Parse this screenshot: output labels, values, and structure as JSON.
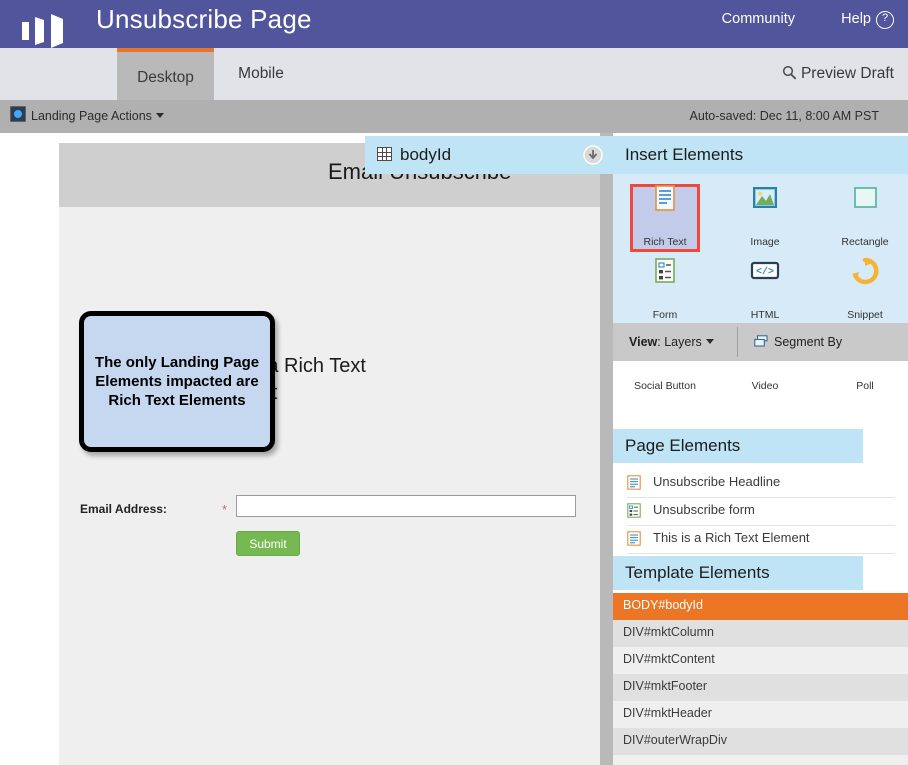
{
  "header": {
    "title": "Unsubscribe Page",
    "community_label": "Community",
    "help_label": "Help",
    "help_icon": "question-circle-icon",
    "logo_icon": "marketo-logo-icon",
    "bg_color": "#51559b"
  },
  "tabs": {
    "items": [
      {
        "label": "Desktop",
        "active": true
      },
      {
        "label": "Mobile",
        "active": false
      }
    ],
    "preview_label": "Preview Draft",
    "preview_icon": "search-icon",
    "active_accent": "#e8762a"
  },
  "action_bar": {
    "landing_page_actions": "Landing Page Actions",
    "actions_icon": "gear-globe-icon",
    "caret_icon": "caret-down-icon",
    "auto_saved": "Auto-saved: Dec 11, 8:00 AM PST"
  },
  "bodyid_bar": {
    "label": "bodyId",
    "grid_icon": "table-grid-icon",
    "download_icon": "arrow-down-circle-icon"
  },
  "canvas": {
    "headline": "Email Unsubscribe",
    "rich_text": "This is a Rich Text Element",
    "form": {
      "email_label": "Email Address:",
      "required_marker": "*",
      "email_value": "",
      "email_placeholder": "",
      "submit_label": "Submit",
      "submit_color": "#76b852"
    },
    "callout": {
      "text": "The only Landing Page Elements impacted are Rich Text Elements",
      "bg_color": "#c5d8f0",
      "border_color": "#000000"
    }
  },
  "right_panel": {
    "insert_title": "Insert Elements",
    "insert_elements": [
      {
        "label": "Rich Text",
        "icon": "rich-text-icon",
        "selected": true
      },
      {
        "label": "Image",
        "icon": "image-icon",
        "selected": false
      },
      {
        "label": "Rectangle",
        "icon": "rectangle-icon",
        "selected": false
      },
      {
        "label": "Form",
        "icon": "form-icon",
        "selected": false
      },
      {
        "label": "HTML",
        "icon": "html-code-icon",
        "selected": false
      },
      {
        "label": "Snippet",
        "icon": "snippet-icon",
        "selected": false
      },
      {
        "label": "Social Button",
        "icon": "social-share-icon",
        "selected": false
      },
      {
        "label": "Video",
        "icon": "video-play-icon",
        "selected": false
      },
      {
        "label": "Poll",
        "icon": "poll-clipboard-icon",
        "selected": false
      }
    ],
    "selection_color": "#f0493c",
    "view_bar": {
      "view_label": "View",
      "view_value": "Layers",
      "caret_icon": "caret-down-icon",
      "segment_label": "Segment By",
      "segment_icon": "segment-layers-icon"
    },
    "page_elements": {
      "title": "Page Elements",
      "items": [
        {
          "label": "Unsubscribe Headline",
          "icon": "rich-text-icon"
        },
        {
          "label": "Unsubscribe form",
          "icon": "form-icon"
        },
        {
          "label": "This is a Rich Text Element",
          "icon": "rich-text-icon"
        }
      ]
    },
    "template_elements": {
      "title": "Template Elements",
      "selected_color": "#ec7526",
      "items": [
        {
          "label": "BODY#bodyId",
          "selected": true
        },
        {
          "label": "DIV#mktColumn",
          "selected": false
        },
        {
          "label": "DIV#mktContent",
          "selected": false
        },
        {
          "label": "DIV#mktFooter",
          "selected": false
        },
        {
          "label": "DIV#mktHeader",
          "selected": false
        },
        {
          "label": "DIV#outerWrapDiv",
          "selected": false
        }
      ]
    }
  }
}
